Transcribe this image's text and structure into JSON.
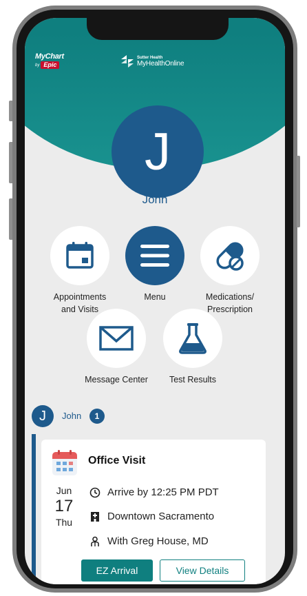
{
  "branding": {
    "mychart_word": "MyChart",
    "mychart_by": "by",
    "epic_word": "Epic",
    "sutter_top": "Sutter Health",
    "sutter_main": "MyHealthOnline"
  },
  "user": {
    "initial": "J",
    "name": "John"
  },
  "tiles": {
    "appointments": {
      "line1": "Appointments",
      "line2": "and Visits",
      "icon": "calendar-icon"
    },
    "menu": {
      "label": "Menu",
      "icon": "hamburger-menu-icon"
    },
    "medications": {
      "line1": "Medications/",
      "line2": "Prescription",
      "icon": "pill-capsule-icon"
    },
    "messages": {
      "label": "Message Center",
      "icon": "envelope-icon"
    },
    "tests": {
      "label": "Test Results",
      "icon": "flask-icon"
    }
  },
  "recent": {
    "initial": "J",
    "name": "John",
    "count": "1"
  },
  "appointment": {
    "title": "Office Visit",
    "month": "Jun",
    "day": "17",
    "weekday": "Thu",
    "arrive": "Arrive by 12:25 PM PDT",
    "location": "Downtown Sacramento",
    "provider": "With Greg House, MD",
    "ez_button": "EZ Arrival",
    "details_button": "View Details"
  },
  "colors": {
    "teal": "#0f7f7f",
    "navy": "#1e5a8c",
    "background": "#ececec"
  }
}
